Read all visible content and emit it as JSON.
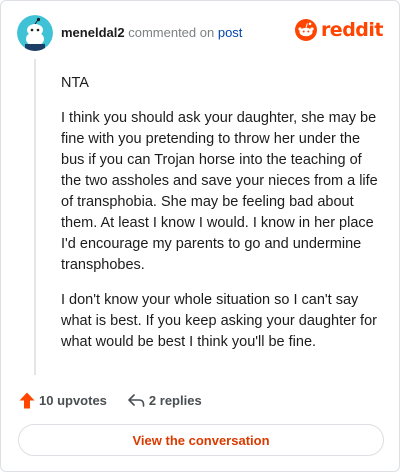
{
  "header": {
    "username": "meneldal2",
    "action_text": "commented on",
    "post_link": "post",
    "brand": "reddit"
  },
  "comment": {
    "paragraphs": [
      "NTA",
      "I think you should ask your daughter, she may be fine with you pretending to throw her under the bus if you can Trojan horse into the teaching of the two assholes and save your nieces from a life of transphobia. She may be feeling bad about them. At least I know I would. I know in her place I'd encourage my parents to go and undermine transphobes.",
      "I don't know your whole situation so I can't say what is best. If you keep asking your daughter for what would be best I think you'll be fine."
    ]
  },
  "footer": {
    "upvotes": "10 upvotes",
    "replies": "2 replies"
  },
  "cta": {
    "label": "View the conversation"
  },
  "colors": {
    "brand": "#ff4500",
    "link": "#0045ac",
    "cta": "#d93a00",
    "avatar": "#3fc1d6"
  }
}
